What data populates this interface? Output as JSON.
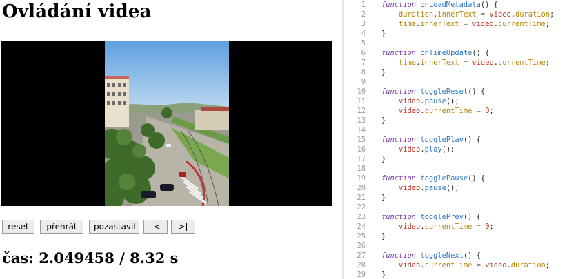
{
  "page": {
    "title": "Ovládání videa"
  },
  "controls": {
    "reset": "reset",
    "play": "přehrát",
    "pause": "pozastavit",
    "prev": "|<",
    "next": ">|"
  },
  "status": {
    "label": "čas:",
    "current_time": "2.049458",
    "separator": "/",
    "duration": "8.32",
    "unit": "s"
  },
  "editor": {
    "lines": [
      {
        "n": "1",
        "tokens": [
          [
            "kw",
            "function"
          ],
          [
            "",
            ""
          ],
          [
            "fn",
            "onLoadMetadata"
          ],
          [
            "",
            "() {"
          ]
        ]
      },
      {
        "n": "2",
        "tokens": [
          [
            "",
            "    "
          ],
          [
            "prop",
            "duration"
          ],
          [
            "",
            "."
          ],
          [
            "prop",
            "innerText"
          ],
          [
            "op",
            " = "
          ],
          [
            "obj",
            "video"
          ],
          [
            "",
            "."
          ],
          [
            "prop",
            "duration"
          ],
          [
            "",
            ";"
          ]
        ]
      },
      {
        "n": "3",
        "tokens": [
          [
            "",
            "    "
          ],
          [
            "prop",
            "time"
          ],
          [
            "",
            "."
          ],
          [
            "prop",
            "innerText"
          ],
          [
            "op",
            " = "
          ],
          [
            "obj",
            "video"
          ],
          [
            "",
            "."
          ],
          [
            "prop",
            "currentTime"
          ],
          [
            "",
            ";"
          ]
        ]
      },
      {
        "n": "4",
        "tokens": [
          [
            "",
            "}"
          ]
        ]
      },
      {
        "n": "5",
        "tokens": []
      },
      {
        "n": "6",
        "tokens": [
          [
            "kw",
            "function"
          ],
          [
            "",
            ""
          ],
          [
            "fn",
            "onTimeUpdate"
          ],
          [
            "",
            "() {"
          ]
        ]
      },
      {
        "n": "7",
        "tokens": [
          [
            "",
            "    "
          ],
          [
            "prop",
            "time"
          ],
          [
            "",
            "."
          ],
          [
            "prop",
            "innerText"
          ],
          [
            "op",
            " = "
          ],
          [
            "obj",
            "video"
          ],
          [
            "",
            "."
          ],
          [
            "prop",
            "currentTime"
          ],
          [
            "",
            ";"
          ]
        ]
      },
      {
        "n": "8",
        "tokens": [
          [
            "",
            "}"
          ]
        ]
      },
      {
        "n": "9",
        "tokens": []
      },
      {
        "n": "10",
        "tokens": [
          [
            "kw",
            "function"
          ],
          [
            "",
            ""
          ],
          [
            "fn",
            "toggleReset"
          ],
          [
            "",
            "() {"
          ]
        ]
      },
      {
        "n": "11",
        "tokens": [
          [
            "",
            "    "
          ],
          [
            "obj",
            "video"
          ],
          [
            "",
            "."
          ],
          [
            "fn",
            "pause"
          ],
          [
            "",
            "();"
          ]
        ]
      },
      {
        "n": "12",
        "tokens": [
          [
            "",
            "    "
          ],
          [
            "obj",
            "video"
          ],
          [
            "",
            "."
          ],
          [
            "prop",
            "currentTime"
          ],
          [
            "op",
            " = "
          ],
          [
            "num",
            "0"
          ],
          [
            "",
            ";"
          ]
        ]
      },
      {
        "n": "13",
        "tokens": [
          [
            "",
            "}"
          ]
        ]
      },
      {
        "n": "14",
        "tokens": []
      },
      {
        "n": "15",
        "tokens": [
          [
            "kw",
            "function"
          ],
          [
            "",
            ""
          ],
          [
            "fn",
            "togglePlay"
          ],
          [
            "",
            "() {"
          ]
        ]
      },
      {
        "n": "16",
        "tokens": [
          [
            "",
            "    "
          ],
          [
            "obj",
            "video"
          ],
          [
            "",
            "."
          ],
          [
            "fn",
            "play"
          ],
          [
            "",
            "();"
          ]
        ]
      },
      {
        "n": "17",
        "tokens": [
          [
            "",
            "}"
          ]
        ]
      },
      {
        "n": "18",
        "tokens": []
      },
      {
        "n": "19",
        "tokens": [
          [
            "kw",
            "function"
          ],
          [
            "",
            ""
          ],
          [
            "fn",
            "togglePause"
          ],
          [
            "",
            "() {"
          ]
        ]
      },
      {
        "n": "20",
        "tokens": [
          [
            "",
            "    "
          ],
          [
            "obj",
            "video"
          ],
          [
            "",
            "."
          ],
          [
            "fn",
            "pause"
          ],
          [
            "",
            "();"
          ]
        ]
      },
      {
        "n": "21",
        "tokens": [
          [
            "",
            "}"
          ]
        ]
      },
      {
        "n": "22",
        "tokens": []
      },
      {
        "n": "23",
        "tokens": [
          [
            "kw",
            "function"
          ],
          [
            "",
            ""
          ],
          [
            "fn",
            "togglePrev"
          ],
          [
            "",
            "() {"
          ]
        ]
      },
      {
        "n": "24",
        "tokens": [
          [
            "",
            "    "
          ],
          [
            "obj",
            "video"
          ],
          [
            "",
            "."
          ],
          [
            "prop",
            "currentTime"
          ],
          [
            "op",
            " = "
          ],
          [
            "num",
            "0"
          ],
          [
            "",
            ";"
          ]
        ]
      },
      {
        "n": "25",
        "tokens": [
          [
            "",
            "}"
          ]
        ]
      },
      {
        "n": "26",
        "tokens": []
      },
      {
        "n": "27",
        "tokens": [
          [
            "kw",
            "function"
          ],
          [
            "",
            ""
          ],
          [
            "fn",
            "toggleNext"
          ],
          [
            "",
            "() {"
          ]
        ]
      },
      {
        "n": "28",
        "tokens": [
          [
            "",
            "    "
          ],
          [
            "obj",
            "video"
          ],
          [
            "",
            "."
          ],
          [
            "prop",
            "currentTime"
          ],
          [
            "op",
            " = "
          ],
          [
            "obj",
            "video"
          ],
          [
            "",
            "."
          ],
          [
            "prop",
            "duration"
          ],
          [
            "",
            ";"
          ]
        ]
      },
      {
        "n": "29",
        "tokens": [
          [
            "",
            "}"
          ]
        ]
      }
    ]
  },
  "colors": {
    "keyword": "#7a3fb0",
    "function_name": "#2b78c9",
    "property": "#b8860b",
    "object": "#c0392b",
    "number": "#c0392b"
  }
}
